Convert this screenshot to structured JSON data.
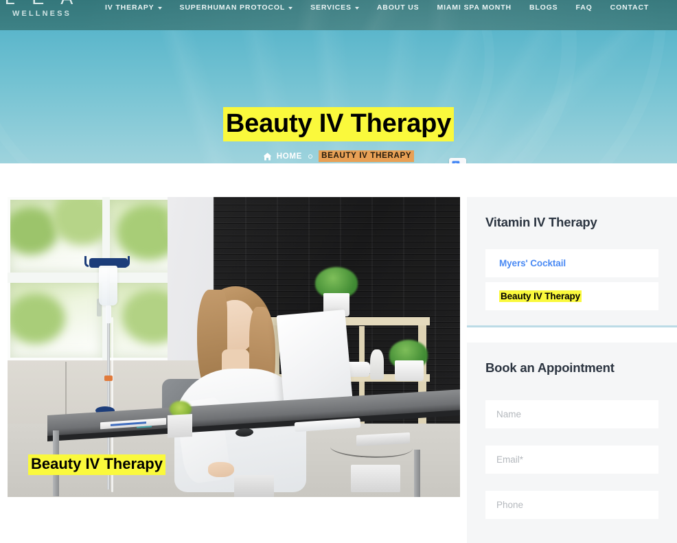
{
  "site": {
    "logo_main": "L E A",
    "logo_sub": "WELLNESS"
  },
  "nav": {
    "items": [
      {
        "label": "IV THERAPY",
        "has_dropdown": true
      },
      {
        "label": "SUPERHUMAN PROTOCOL",
        "has_dropdown": true
      },
      {
        "label": "SERVICES",
        "has_dropdown": true
      },
      {
        "label": "ABOUT US",
        "has_dropdown": false
      },
      {
        "label": "MIAMI SPA MONTH",
        "has_dropdown": false
      },
      {
        "label": "BLOGS",
        "has_dropdown": false
      },
      {
        "label": "FAQ",
        "has_dropdown": false
      },
      {
        "label": "CONTACT",
        "has_dropdown": false
      }
    ]
  },
  "hero": {
    "title": "Beauty IV Therapy",
    "breadcrumb_home": "HOME",
    "breadcrumb_current": "BEAUTY IV THERAPY",
    "title_highlight_color": "#faf93c",
    "breadcrumb_highlight_color": "#e8a055",
    "background_color": "#73c2d2"
  },
  "translate_widget": {
    "name": "Google Translate"
  },
  "article": {
    "image_caption": "Beauty IV Therapy",
    "image_alt": "Woman working at a desk with an IV drip stand beside her"
  },
  "sidebar": {
    "categories_widget": {
      "title": "Vitamin IV Therapy",
      "items": [
        {
          "label": "Myers' Cocktail",
          "current": false
        },
        {
          "label": "Beauty IV Therapy",
          "current": true
        }
      ]
    },
    "appointment_widget": {
      "title": "Book an Appointment",
      "fields": [
        {
          "placeholder": "Name"
        },
        {
          "placeholder": "Email*"
        },
        {
          "placeholder": "Phone"
        }
      ]
    }
  }
}
